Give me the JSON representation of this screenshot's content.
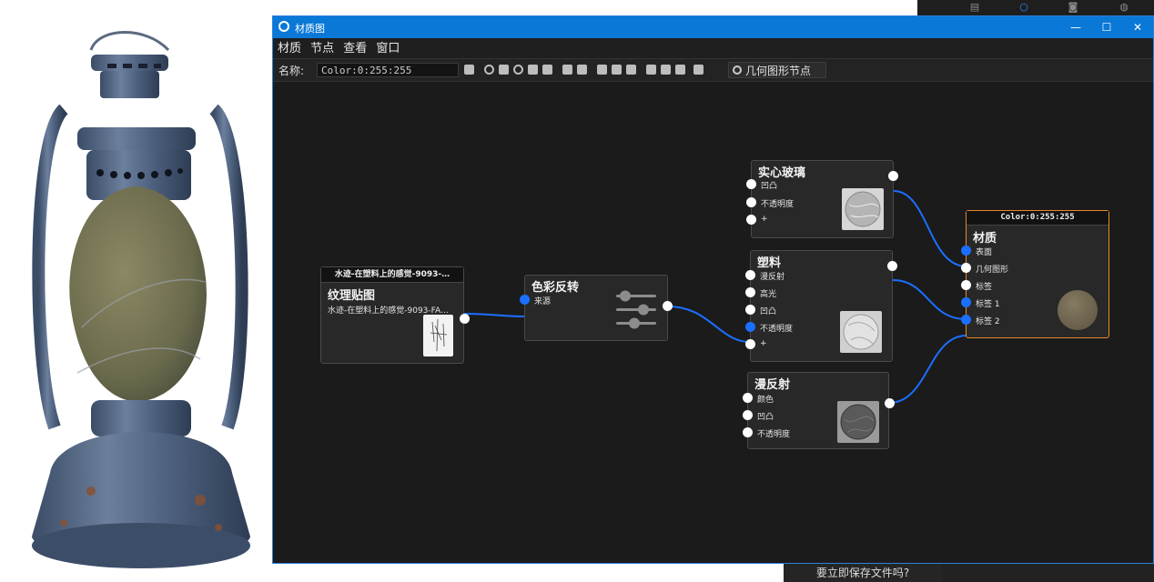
{
  "window": {
    "title": "材质图",
    "minimize": "—",
    "maximize": "☐",
    "close": "✕"
  },
  "menu": [
    "材质",
    "节点",
    "查看",
    "窗口"
  ],
  "toolbar": {
    "name_label": "名称:",
    "name_value": "Color:0:255:255",
    "geometry_button": "几何图形节点"
  },
  "nodes": {
    "texture": {
      "header": "水迹-在塑料上的感觉-9093-…",
      "title": "纹理贴图",
      "subtitle": "水迹-在塑料上的感觉-9093-FA…"
    },
    "invert": {
      "title": "色彩反转",
      "inputs": [
        "来源"
      ]
    },
    "glass": {
      "title": "实心玻璃",
      "inputs": [
        "凹凸",
        "不透明度",
        "+"
      ]
    },
    "plastic": {
      "title": "塑料",
      "inputs": [
        "漫反射",
        "高光",
        "凹凸",
        "不透明度",
        "+"
      ]
    },
    "diffuse": {
      "title": "漫反射",
      "inputs": [
        "颜色",
        "凹凸",
        "不透明度"
      ]
    },
    "material": {
      "header": "Color:0:255:255",
      "title": "材质",
      "inputs": [
        "表面",
        "几何图形",
        "标签",
        "标签 1",
        "标签 2"
      ]
    }
  },
  "dialog": {
    "text": "要立即保存文件吗?"
  },
  "colors": {
    "accent": "#0a78d7",
    "wire": "#1b6fff",
    "material_border": "#e8892a",
    "canvas": "#1b1b1b"
  }
}
